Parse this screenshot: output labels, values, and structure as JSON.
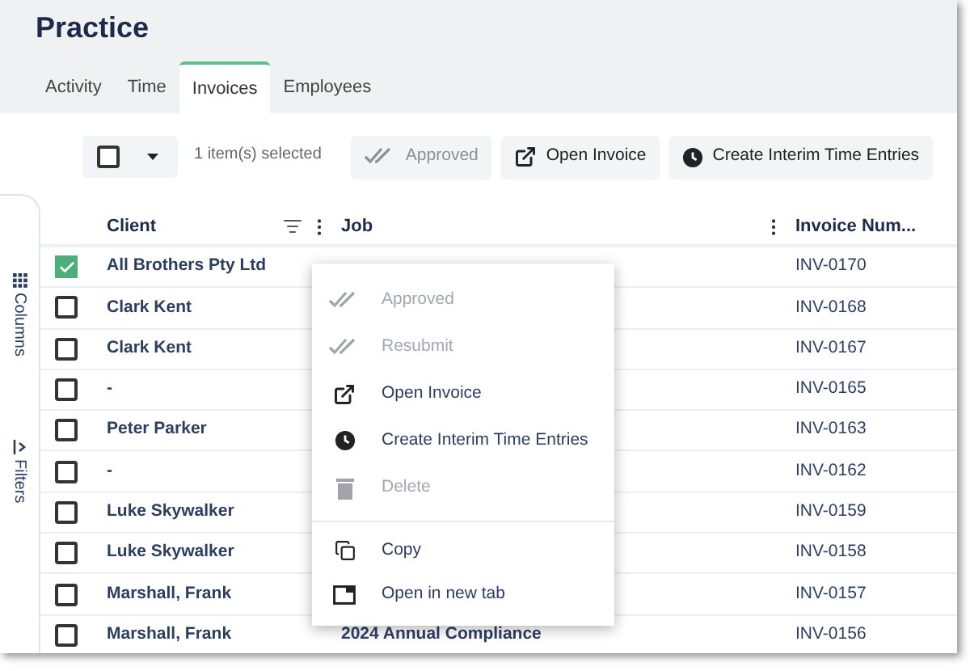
{
  "title": "Practice",
  "tabs": [
    {
      "label": "Activity",
      "selected": false
    },
    {
      "label": "Time",
      "selected": false
    },
    {
      "label": "Invoices",
      "selected": true
    },
    {
      "label": "Employees",
      "selected": false
    }
  ],
  "toolbar": {
    "select_all_checked": false,
    "selection_count": "1 item(s) selected",
    "buttons": [
      {
        "label": "Approved",
        "kind": "approve",
        "disabled": true
      },
      {
        "label": "Open Invoice",
        "kind": "open",
        "disabled": false
      },
      {
        "label": "Create Interim Time Entries",
        "kind": "clock",
        "disabled": false
      }
    ]
  },
  "side_panel": [
    {
      "label": "Columns",
      "kind": "grid"
    },
    {
      "label": "Filters",
      "kind": "filter"
    }
  ],
  "table": {
    "columns": [
      "Client",
      "Job",
      "Invoice Num..."
    ],
    "rows": [
      {
        "checked": true,
        "client": "All Brothers Pty Ltd",
        "invoice": "INV-0170"
      },
      {
        "checked": false,
        "client": "Clark Kent",
        "invoice": "INV-0168"
      },
      {
        "checked": false,
        "client": "Clark Kent",
        "invoice": "INV-0167"
      },
      {
        "checked": false,
        "client": "-",
        "invoice": "INV-0165"
      },
      {
        "checked": false,
        "client": "Peter Parker",
        "invoice": "INV-0163"
      },
      {
        "checked": false,
        "client": "-",
        "invoice": "INV-0162"
      },
      {
        "checked": false,
        "client": "Luke Skywalker",
        "invoice": "INV-0159"
      },
      {
        "checked": false,
        "client": "Luke Skywalker",
        "invoice": "INV-0158"
      },
      {
        "checked": false,
        "client": "Marshall, Frank",
        "invoice": "INV-0157"
      },
      {
        "checked": false,
        "client": "Marshall, Frank",
        "job": "2024 Annual Compliance",
        "invoice": "INV-0156"
      }
    ]
  },
  "context_menu": {
    "sections": [
      [
        {
          "label": "Approved",
          "kind": "approve",
          "disabled": true
        },
        {
          "label": "Resubmit",
          "kind": "approve",
          "disabled": true
        },
        {
          "label": "Open Invoice",
          "kind": "open",
          "disabled": false
        },
        {
          "label": "Create Interim Time Entries",
          "kind": "clock",
          "disabled": false
        },
        {
          "label": "Delete",
          "kind": "trash",
          "disabled": true
        }
      ],
      [
        {
          "label": "Copy",
          "kind": "copy",
          "disabled": false
        },
        {
          "label": "Open in new tab",
          "kind": "window",
          "disabled": false
        }
      ]
    ]
  }
}
